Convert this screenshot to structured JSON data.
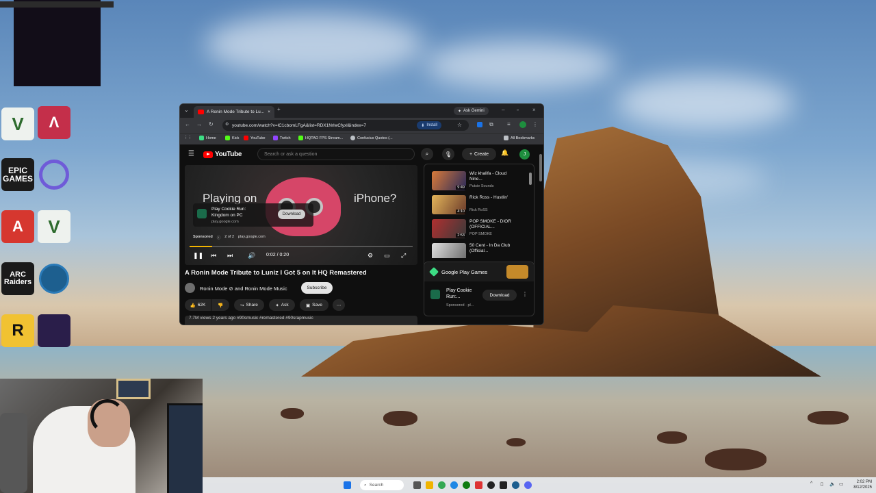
{
  "browser": {
    "tab_title": "A Ronin Mode Tribute to Lu...",
    "ask_gemini": "Ask Gemini",
    "url": "youtube.com/watch?v=lC1cbomLFgA&list=RDX1NrlwCfyxl&index=7",
    "install_label": "Install",
    "bookmarks": [
      "Home",
      "Kick",
      "YouTube",
      "Twitch",
      "HQTAO FPS Stream...",
      "Confucius Quotes (...",
      "All Bookmarks"
    ]
  },
  "youtube": {
    "logo_text": "YouTube",
    "search_placeholder": "Search or ask a question",
    "create_label": "Create",
    "avatar_letter": "J",
    "player": {
      "ad_headline_left": "Playing on",
      "ad_headline_right": "iPhone?",
      "ad_app_title": "Play Cookie Run: Kingdom on PC",
      "ad_domain": "play.google.com",
      "ad_download": "Download",
      "sponsored": "Sponsored",
      "ad_count": "2 of 2",
      "ad_site": "play.google.com",
      "time": "0:02 / 0:20",
      "progress": 0.1
    },
    "video_title": "A Ronin Mode Tribute to Luniz I Got 5 on It HQ Remastered",
    "channel": "Ronin Mode ⊘ and Ronin Mode Music",
    "subscribe": "Subscribe",
    "likes": "62K",
    "share": "Share",
    "ask": "Ask",
    "save": "Save",
    "views_line": "7.7M views  2 years ago  #90smusic #remastered #90srapmusic",
    "recommendations": [
      {
        "title": "Wiz khalifa - Cloud Nine...",
        "channel": "Putsie Sounds",
        "duration": "9:49"
      },
      {
        "title": "Rick Ross - Hustlin'",
        "channel": "Rick RoSS",
        "duration": "4:10"
      },
      {
        "title": "POP SMOKE - DIOR (OFFICIAL...",
        "channel": "POP SMOKE",
        "duration": "2:53"
      },
      {
        "title": "50 Cent - In Da Club (Official...",
        "channel": "",
        "duration": ""
      }
    ],
    "gp_card": {
      "title": "Google Play Games",
      "app": "Play Cookie Run:...",
      "sponsored": "Sponsored · pl...",
      "download": "Download"
    }
  },
  "desktop": {
    "icons": [
      "Rockstar Games",
      "Epic Games",
      "Apex",
      "ARC Raiders",
      "Steam",
      "Ubisoft",
      "GTA V",
      "Launcher"
    ],
    "icon_texts": {
      "epic": "EPIC\nGAMES",
      "arc": "ARC\nRaiders",
      "r": "R"
    }
  },
  "taskbar": {
    "search": "Search",
    "time": "2:02 PM",
    "date": "8/12/2025"
  }
}
